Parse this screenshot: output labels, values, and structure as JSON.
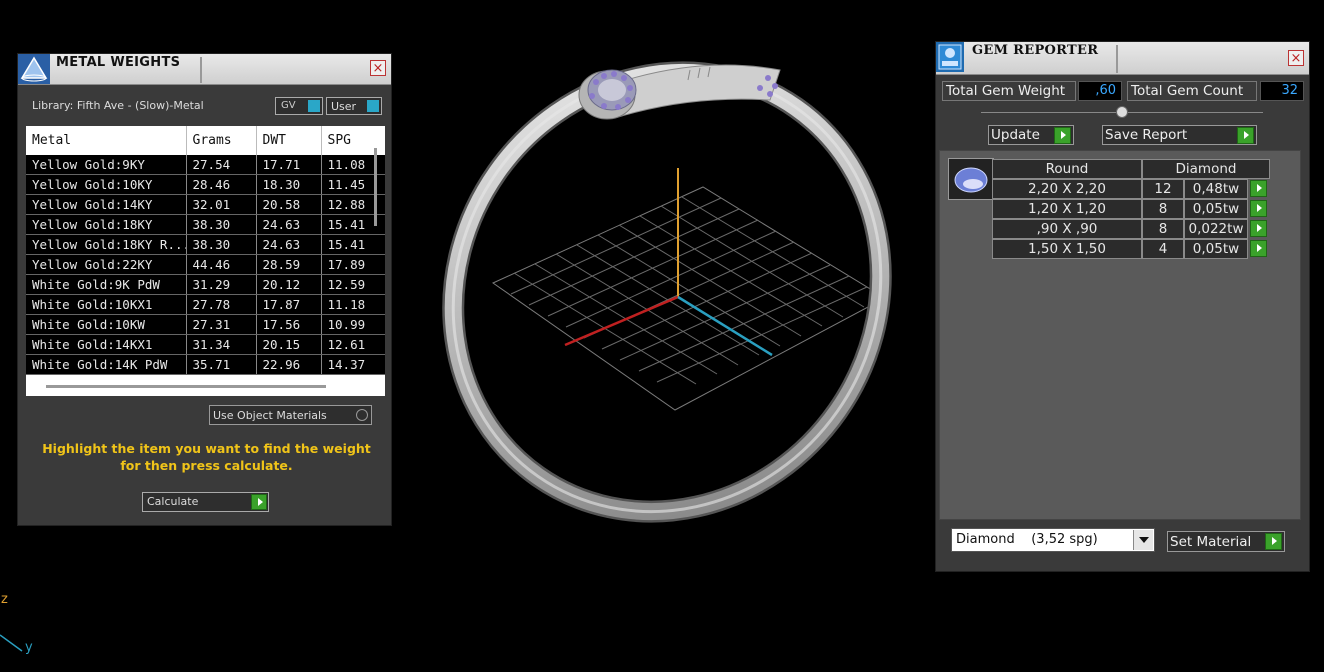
{
  "metal_weights": {
    "title": "METAL WEIGHTS",
    "close": "×",
    "library": "Library: Fifth Ave - (Slow)-Metal",
    "gv_label": "GV",
    "user_label": "User",
    "columns": [
      "Metal",
      "Grams",
      "DWT",
      "SPG"
    ],
    "rows": [
      [
        "Yellow Gold:9KY",
        "27.54",
        "17.71",
        "11.08"
      ],
      [
        "Yellow Gold:10KY",
        "28.46",
        "18.30",
        "11.45"
      ],
      [
        "Yellow Gold:14KY",
        "32.01",
        "20.58",
        "12.88"
      ],
      [
        "Yellow Gold:18KY",
        "38.30",
        "24.63",
        "15.41"
      ],
      [
        "Yellow Gold:18KY R...",
        "38.30",
        "24.63",
        "15.41"
      ],
      [
        "Yellow Gold:22KY",
        "44.46",
        "28.59",
        "17.89"
      ],
      [
        "White Gold:9K PdW",
        "31.29",
        "20.12",
        "12.59"
      ],
      [
        "White Gold:10KX1",
        "27.78",
        "17.87",
        "11.18"
      ],
      [
        "White Gold:10KW",
        "27.31",
        "17.56",
        "10.99"
      ],
      [
        "White Gold:14KX1",
        "31.34",
        "20.15",
        "12.61"
      ],
      [
        "White Gold:14K PdW",
        "35.71",
        "22.96",
        "14.37"
      ]
    ],
    "use_object_materials": "Use Object Materials",
    "instruction": "Highlight the item you want to find the weight for then press calculate.",
    "calculate": "Calculate"
  },
  "gem_reporter": {
    "title": "GEM REPORTER",
    "close": "×",
    "total_weight_label": "Total Gem Weight",
    "total_weight_value": ",60",
    "total_count_label": "Total Gem Count",
    "total_count_value": "32",
    "update": "Update",
    "save_report": "Save Report",
    "shape_header": "Round",
    "material_header": "Diamond",
    "gems": [
      {
        "size": "2,20 X 2,20",
        "count": "12",
        "weight": "0,48tw"
      },
      {
        "size": "1,20 X 1,20",
        "count": "8",
        "weight": "0,05tw"
      },
      {
        "size": ",90 X ,90",
        "count": "8",
        "weight": "0,022tw"
      },
      {
        "size": "1,50 X 1,50",
        "count": "4",
        "weight": "0,05tw"
      }
    ],
    "material_select": "Diamond    (3,52 spg)",
    "set_material": "Set Material"
  },
  "viewport": {
    "axis_z": "z",
    "axis_y": "y"
  },
  "colors": {
    "instruction_text": "#f0c419",
    "accent_green": "#3aa22a",
    "value_blue": "#3aa8ff"
  }
}
